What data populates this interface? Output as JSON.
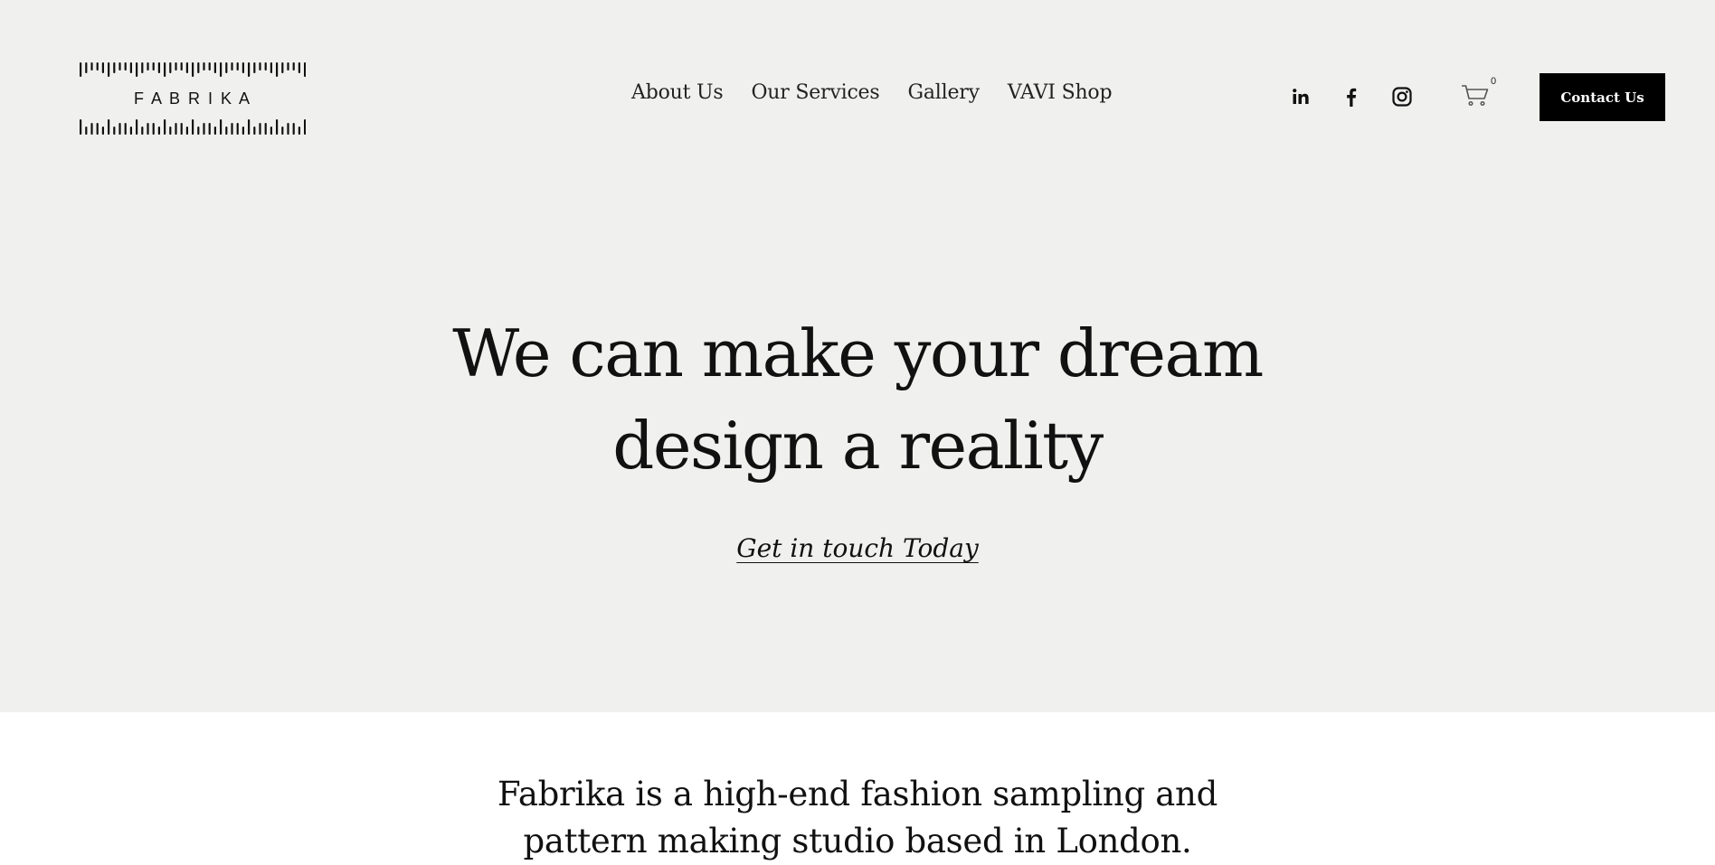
{
  "header": {
    "logo_text": "F A B R I K A",
    "nav": [
      {
        "label": "About Us"
      },
      {
        "label": "Our Services"
      },
      {
        "label": "Gallery"
      },
      {
        "label": "VAVI Shop"
      }
    ],
    "social_icons": [
      "linkedin-icon",
      "facebook-icon",
      "instagram-icon"
    ],
    "cart_count": "0",
    "contact_button": "Contact Us"
  },
  "hero": {
    "title_line1": "We can make your dream",
    "title_line2": "design a reality",
    "cta_link": "Get in touch Today"
  },
  "intro": {
    "line1": "Fabrika is a high-end fashion sampling and",
    "line2": "pattern making studio based in London."
  },
  "colors": {
    "hero_background": "#f0f0ee",
    "page_background": "#ffffff",
    "button_background": "#000000",
    "text": "#111111"
  }
}
